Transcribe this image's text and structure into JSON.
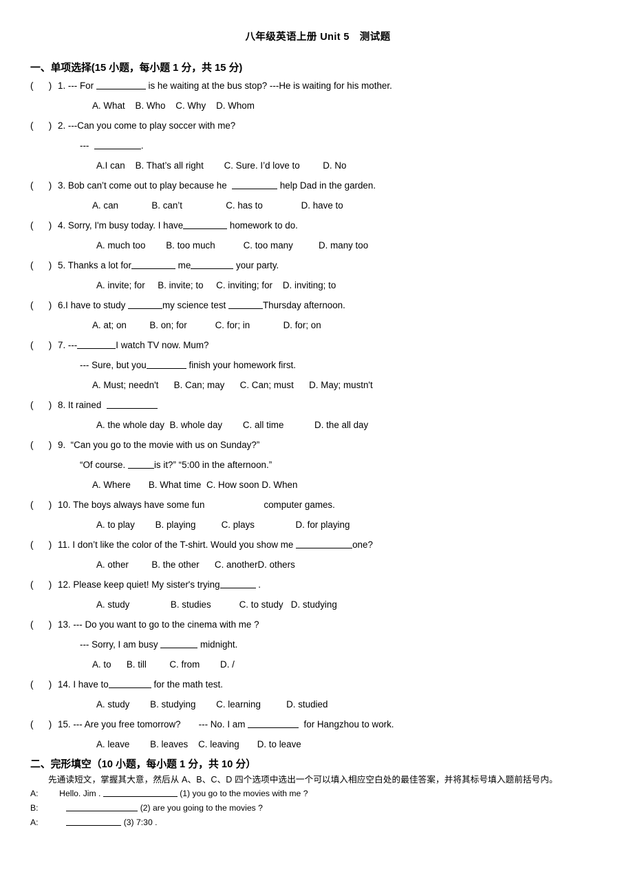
{
  "title": "八年级英语上册 Unit 5　测试题",
  "section1": {
    "heading": "一、单项选择(15 小题，每小题 1 分，共 15 分)",
    "questions": [
      {
        "marker": "(      )",
        "num": "1.",
        "stem_before": " --- For ",
        "blank_width": 72,
        "stem_after": " is he waiting at the bus stop? ---He is waiting for his mother.",
        "options": "A. What    B. Who    C. Why    D. Whom"
      },
      {
        "marker": "(      )",
        "num": "2.",
        "stem_before": " ---Can you come to play soccer with me?",
        "sub_before": "---  ",
        "sub_blank_width": 68,
        "sub_after": ".",
        "options": "A.I can    B. That’s all right        C. Sure. I’d love to         D. No"
      },
      {
        "marker": "(      )",
        "num": "3.",
        "stem_before": " Bob can’t come out to play because he  ",
        "blank_width": 66,
        "stem_after": " help Dad in the garden.",
        "options": "A. can             B. can’t                 C. has to               D. have to"
      },
      {
        "marker": "(      )",
        "num": "4.",
        "stem_before": " Sorry, I'm busy today. I have",
        "blank_width": 64,
        "stem_after": " homework to do.",
        "options": "A. much too        B. too much           C. too many          D. many too"
      },
      {
        "marker": "(      )",
        "num": "5.",
        "stem_before": " Thanks a lot for",
        "blank_width": 64,
        "stem_mid": " me",
        "blank2_width": 62,
        "stem_after": " your party.",
        "options": "A. invite; for     B. invite; to     C. inviting; for    D. inviting; to"
      },
      {
        "marker": "(      )",
        "num": "6.",
        "stem_before": "I have to study ",
        "blank_width": 50,
        "stem_mid": "my science test ",
        "blank2_width": 50,
        "stem_after": "Thursday afternoon.",
        "options": "A. at; on         B. on; for           C. for; in             D. for; on"
      },
      {
        "marker": "(      )",
        "num": "7.",
        "stem_before": " ---",
        "blank_width": 56,
        "stem_after": "I watch TV now. Mum?",
        "sub_before": "--- Sure, but you",
        "sub_blank_width": 58,
        "sub_after": " finish your homework first.",
        "options": "A. Must; needn't      B. Can; may      C. Can; must      D. May; mustn't"
      },
      {
        "marker": "(      )",
        "num": "8.",
        "stem_before": " It rained  ",
        "blank_width": 74,
        "stem_after": "",
        "options": "A. the whole day  B. whole day        C. all time            D. the all day"
      },
      {
        "marker": "(      )",
        "num": "9.",
        "stem_before": "  “Can you go to the movie with us on Sunday?”",
        "sub_before": "“Of course. ",
        "sub_blank_width": 38,
        "sub_after": "is it?” “5:00 in the afternoon.”",
        "options": "A. Where       B. What time  C. How soon D. When"
      },
      {
        "marker": "(      )",
        "num": "10.",
        "stem_before": " The boys always have some fun",
        "gap_width": 86,
        "stem_after": "computer games.",
        "options": "A. to play        B. playing          C. plays                D. for playing"
      },
      {
        "marker": "(      )",
        "num": "11.",
        "stem_before": " I don’t like the color of the T-shirt. Would you show me ",
        "blank_width": 82,
        "stem_after": "one?",
        "options": "A. other         B. the other      C. anotherD. others"
      },
      {
        "marker": "(      )",
        "num": "12.",
        "stem_before": " Please keep quiet! My sister's trying",
        "blank_width": 52,
        "stem_after": " .",
        "options": "A. study                B. studies           C. to study   D. studying"
      },
      {
        "marker": "(      )",
        "num": "13.",
        "stem_before": " --- Do you want to go to the cinema with me ?",
        "sub_before": "--- Sorry, I am busy ",
        "sub_blank_width": 54,
        "sub_after": " midnight.",
        "options": "A. to      B. till         C. from        D. /"
      },
      {
        "marker": "(      )",
        "num": "14.",
        "stem_before": " I have to",
        "blank_width": 62,
        "stem_after": " for the math test.",
        "options": "A. study        B. studying        C. learning          D. studied"
      },
      {
        "marker": "(      )",
        "num": "15.",
        "stem_before": " --- Are you free tomorrow?       --- No. I am ",
        "blank_width": 74,
        "stem_after": "  for Hangzhou to work.",
        "options": "A. leave        B. leaves    C. leaving       D. to leave"
      }
    ]
  },
  "section2": {
    "heading": "二、完形填空（10 小题，每小题 1 分，共 10 分）",
    "instruction": "先通读短文，掌握其大意，然后从 A、B、C、D 四个选项中选出一个可以填入相应空白处的最佳答案，并将其标号填入题前括号内。",
    "dialog": [
      {
        "speaker": "A:",
        "before": "   Hello. Jim . ",
        "blank_width": 108,
        "after": " (1) you go to the movies with me ?"
      },
      {
        "speaker": "B:",
        "before": "      ",
        "blank_width": 104,
        "after": " (2) are you going to the movies ?"
      },
      {
        "speaker": "A:",
        "before": "      ",
        "blank_width": 80,
        "after": " (3) 7:30 ."
      }
    ]
  }
}
